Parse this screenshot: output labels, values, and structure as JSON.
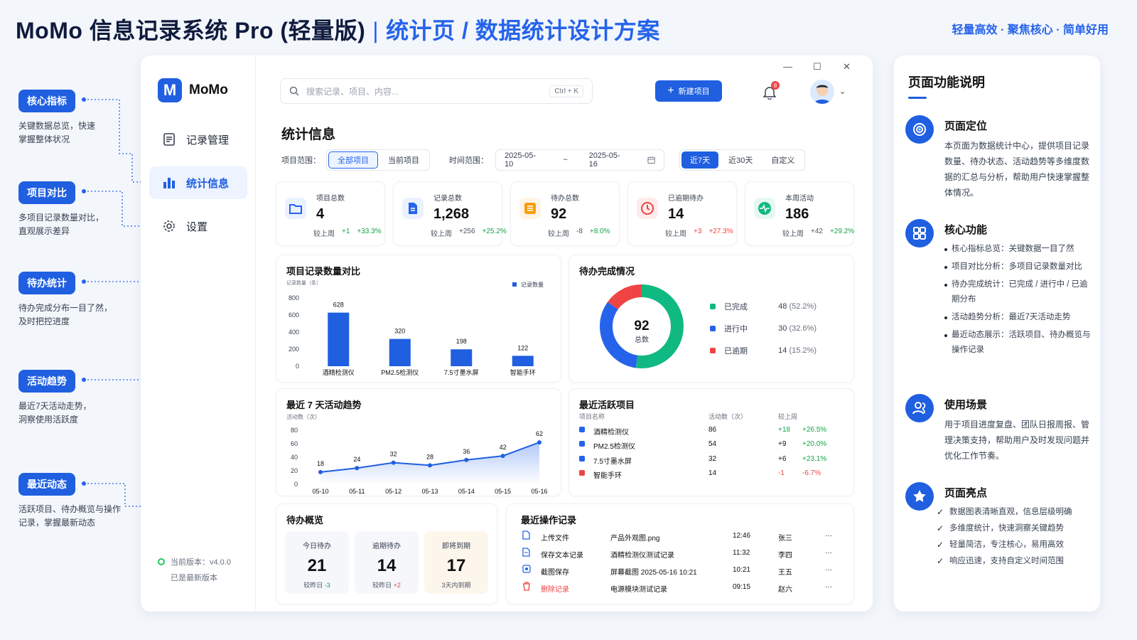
{
  "header": {
    "title": "MoMo 信息记录系统 Pro (轻量版)",
    "divider": "|",
    "subtitle": "统计页 / 数据统计设计方案",
    "tagline": "轻量高效 · 聚焦核心 · 简单好用"
  },
  "annotations": [
    {
      "title": "核心指标",
      "desc": "关键数据总览，快速掌握整体状况"
    },
    {
      "title": "项目对比",
      "desc": "多项目记录数量对比，直观展示差异"
    },
    {
      "title": "待办统计",
      "desc": "待办完成分布一目了然，及时把控进度"
    },
    {
      "title": "活动趋势",
      "desc": "最近7天活动走势，洞察使用活跃度"
    },
    {
      "title": "最近动态",
      "desc": "活跃项目、待办概览与操作记录，掌握最新动态"
    }
  ],
  "sidebar": {
    "logo_letter": "M",
    "logo": "MoMo",
    "items": [
      {
        "label": "记录管理"
      },
      {
        "label": "统计信息"
      },
      {
        "label": "设置"
      }
    ],
    "version": "当前版本：v4.0.0",
    "version_status": "已是最新版本"
  },
  "topbar": {
    "search_placeholder": "搜索记录、项目、内容...",
    "shortcut": "Ctrl + K",
    "new_button": "新建项目",
    "notifications": "8"
  },
  "window_controls": {
    "min": "—",
    "max": "☐",
    "close": "✕"
  },
  "page": {
    "title": "统计信息"
  },
  "filters": {
    "scope_label": "项目范围：",
    "scope_options": [
      "全部项目",
      "当前项目"
    ],
    "scope_selected": "全部项目",
    "time_label": "时间范围：",
    "date_from": "2025-05-10",
    "date_sep": "~",
    "date_to": "2025-05-16",
    "ranges": [
      "近7天",
      "近30天",
      "自定义"
    ],
    "range_selected": "近7天"
  },
  "stats": [
    {
      "label": "项目总数",
      "value": "4",
      "cmp_label": "较上周",
      "delta": "+1",
      "pct": "+33.3%",
      "color": "#2563eb",
      "icon": "folder-icon"
    },
    {
      "label": "记录总数",
      "value": "1,268",
      "cmp_label": "较上周",
      "delta": "+256",
      "pct": "+25.2%",
      "color": "#2563eb",
      "icon": "document-icon"
    },
    {
      "label": "待办总数",
      "value": "92",
      "cmp_label": "较上周",
      "delta": "-8",
      "pct": "+8.0%",
      "color": "#f59e0b",
      "icon": "list-icon"
    },
    {
      "label": "已逾期待办",
      "value": "14",
      "cmp_label": "较上周",
      "delta": "+3",
      "pct": "+27.3%",
      "color": "#ef4444",
      "icon": "clock-icon"
    },
    {
      "label": "本周活动",
      "value": "186",
      "cmp_label": "较上周",
      "delta": "+42",
      "pct": "+29.2%",
      "color": "#10b981",
      "icon": "activity-icon"
    }
  ],
  "bar_card": {
    "title": "项目记录数量对比",
    "unit": "记录数量（条）",
    "legend": "记录数量"
  },
  "donut_card": {
    "title": "待办完成情况",
    "center_value": "92",
    "center_label": "总数",
    "items": [
      {
        "label": "已完成",
        "count": "48",
        "pct": "(52.2%)",
        "value": 48,
        "color": "#10b981"
      },
      {
        "label": "进行中",
        "count": "30",
        "pct": "(32.6%)",
        "value": 30,
        "color": "#2563eb"
      },
      {
        "label": "已逾期",
        "count": "14",
        "pct": "(15.2%)",
        "value": 14,
        "color": "#ef4444"
      }
    ]
  },
  "line_card": {
    "title": "最近 7 天活动趋势",
    "unit": "活动数（次）"
  },
  "projects_card": {
    "title": "最近活跃项目",
    "headers": [
      "项目名称",
      "活动数（次）",
      "较上周"
    ],
    "rows": [
      {
        "name": "酒精检测仪",
        "count": "86",
        "delta": "+18",
        "pct": "+26.5%",
        "color": "#2563eb",
        "up": true
      },
      {
        "name": "PM2.5检测仪",
        "count": "54",
        "delta": "+9",
        "pct": "+20.0%",
        "color": "#2563eb",
        "up": true
      },
      {
        "name": "7.5寸墨水屏",
        "count": "32",
        "delta": "+6",
        "pct": "+23.1%",
        "color": "#2563eb",
        "up": true
      },
      {
        "name": "智能手环",
        "count": "14",
        "delta": "-1",
        "pct": "-6.7%",
        "color": "#ef4444",
        "up": false
      }
    ]
  },
  "todo_card": {
    "title": "待办概览",
    "items": [
      {
        "label": "今日待办",
        "value": "21",
        "note": "较昨日",
        "delta": "-3",
        "bg": "#f5f7fb"
      },
      {
        "label": "逾期待办",
        "value": "14",
        "note": "较昨日",
        "delta": "+2",
        "bg": "#f5f7fb"
      },
      {
        "label": "即将到期",
        "value": "17",
        "note": "3天内到期",
        "delta": "",
        "bg": "#fdf6ec"
      }
    ]
  },
  "ops_card": {
    "title": "最近操作记录",
    "more": "···",
    "rows": [
      {
        "action": "上传文件",
        "target": "产品外观图.png",
        "time": "12:46",
        "user": "张三",
        "danger": false
      },
      {
        "action": "保存文本记录",
        "target": "酒精检测仪测试记录",
        "time": "11:32",
        "user": "李四",
        "danger": false
      },
      {
        "action": "截图保存",
        "target": "屏幕截图 2025-05-16 10:21",
        "time": "10:21",
        "user": "王五",
        "danger": false
      },
      {
        "action": "删除记录",
        "target": "电源模块测试记录",
        "time": "09:15",
        "user": "赵六",
        "danger": true
      }
    ]
  },
  "panel": {
    "title": "页面功能说明",
    "sections": [
      {
        "title": "页面定位",
        "body": "本页面为数据统计中心，提供项目记录数量、待办状态、活动趋势等多维度数据的汇总与分析，帮助用户快速掌握整体情况。"
      },
      {
        "title": "核心功能",
        "bullets": [
          "核心指标总览：关键数据一目了然",
          "项目对比分析：多项目记录数量对比",
          "待办完成统计：已完成 / 进行中 / 已逾期分布",
          "活动趋势分析：最近7天活动走势",
          "最近动态展示：活跃项目、待办概览与操作记录"
        ]
      },
      {
        "title": "使用场景",
        "body": "用于项目进度复盘、团队日报周报、管理决策支持，帮助用户及时发现问题并优化工作节奏。"
      },
      {
        "title": "页面亮点",
        "checks": [
          "数据图表清晰直观，信息层级明确",
          "多维度统计，快速洞察关键趋势",
          "轻量简洁，专注核心，易用高效",
          "响应迅速，支持自定义时间范围"
        ]
      }
    ]
  },
  "chart_data": [
    {
      "type": "bar",
      "title": "项目记录数量对比",
      "ylabel": "记录数量（条）",
      "categories": [
        "酒精检测仪",
        "PM2.5检测仪",
        "7.5寸墨水屏",
        "智能手环"
      ],
      "series": [
        {
          "name": "记录数量",
          "values": [
            628,
            320,
            198,
            122
          ]
        }
      ],
      "ylim": [
        0,
        800
      ],
      "yticks": [
        0,
        200,
        400,
        600,
        800
      ],
      "color": "#1f5fe0"
    },
    {
      "type": "pie",
      "title": "待办完成情况",
      "labels": [
        "已完成",
        "进行中",
        "已逾期"
      ],
      "values": [
        48,
        30,
        14
      ]
    },
    {
      "type": "area",
      "title": "最近 7 天活动趋势",
      "ylabel": "活动数（次）",
      "x": [
        "05-10",
        "05-11",
        "05-12",
        "05-13",
        "05-14",
        "05-15",
        "05-16"
      ],
      "series": [
        {
          "values": [
            18,
            24,
            32,
            28,
            36,
            42,
            62
          ]
        }
      ],
      "ylim": [
        0,
        80
      ],
      "yticks": [
        0,
        20,
        40,
        60,
        80
      ],
      "color": "#1f5fe0"
    }
  ]
}
